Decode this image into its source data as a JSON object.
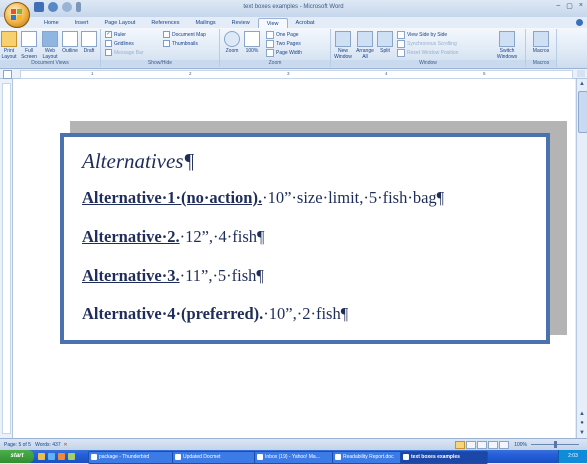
{
  "window": {
    "title": "text boxes examples - Microsoft Word",
    "controls": [
      "–",
      "▢",
      "×"
    ]
  },
  "quick_access": {
    "icons": [
      "save-icon",
      "undo-icon",
      "redo-icon",
      "customize-icon"
    ]
  },
  "tabs": [
    {
      "label": "Home"
    },
    {
      "label": "Insert"
    },
    {
      "label": "Page Layout"
    },
    {
      "label": "References"
    },
    {
      "label": "Mailings"
    },
    {
      "label": "Review"
    },
    {
      "label": "View"
    },
    {
      "label": "Acrobat"
    }
  ],
  "ribbon": {
    "document_views": {
      "label": "Document Views",
      "buttons": [
        "Print Layout",
        "Full Screen Reading",
        "Web Layout",
        "Outline",
        "Draft"
      ]
    },
    "show_hide": {
      "label": "Show/Hide",
      "ruler": "Ruler",
      "gridlines": "Gridlines",
      "message_bar": "Message Bar",
      "document_map": "Document Map",
      "thumbnails": "Thumbnails"
    },
    "zoom": {
      "label": "Zoom",
      "zoom": "Zoom",
      "hundred": "100%",
      "one_page": "One Page",
      "two_pages": "Two Pages",
      "page_width": "Page Width"
    },
    "window": {
      "label": "Window",
      "new_window": "New Window",
      "arrange_all": "Arrange All",
      "split": "Split",
      "view_side": "View Side by Side",
      "sync_scroll": "Synchronous Scrolling",
      "reset_pos": "Reset Window Position",
      "switch": "Switch Windows"
    },
    "macros": {
      "label": "Macros",
      "button": "Macros"
    }
  },
  "ruler": {
    "ticks": [
      "1",
      "2",
      "3",
      "4",
      "5"
    ]
  },
  "textbox": {
    "heading": "Alternatives¶",
    "lines": [
      {
        "bold": "Alternative·1·(no·action).",
        "rest": "·10”·size·limit,·5·fish·bag¶",
        "underlined": true
      },
      {
        "bold": "Alternative·2.",
        "rest": "·12”,·4·fish¶",
        "underlined": true
      },
      {
        "bold": "Alternative·3.",
        "rest": "·11”,·5·fish¶",
        "underlined": true
      },
      {
        "bold": "Alternative·4·(preferred).",
        "rest": "·10”,·2·fish¶",
        "underlined": false
      }
    ]
  },
  "status": {
    "page": "Page: 5 of 5",
    "words": "Words: 437",
    "zoom": "100%",
    "zoom_fraction": 0.5
  },
  "taskbar": {
    "start": "start",
    "tasks": [
      {
        "label": "package - Thunderbird"
      },
      {
        "label": "Updated Docmet"
      },
      {
        "label": "Inbox (19) - Yahoo! Ma..."
      },
      {
        "label": "Readability Report.doc"
      },
      {
        "label": "text boxes examples"
      }
    ],
    "clock": "2:03"
  },
  "colors": {
    "accent": "#4a72ae",
    "text": "#1f2d5a",
    "ribbon": "#dbe6f4",
    "taskbar": "#245edb"
  }
}
